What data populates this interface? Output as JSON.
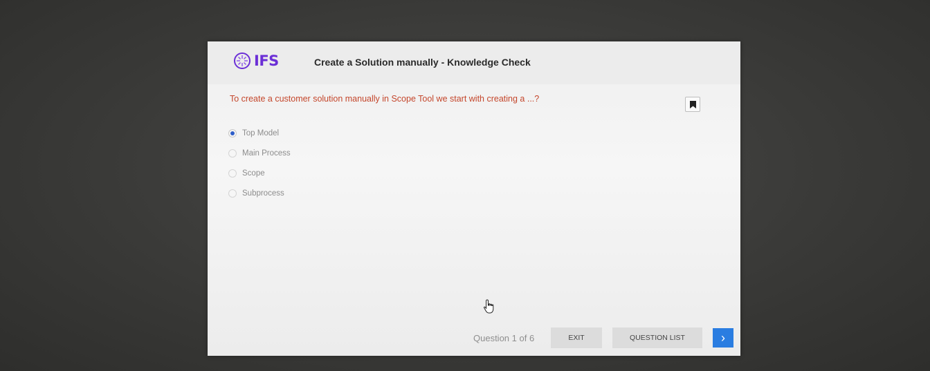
{
  "header": {
    "logo_text": "IFS",
    "course_title": "Create a Solution manually - Knowledge Check"
  },
  "question": {
    "text": "To create a customer solution manually in Scope Tool we start with creating a ...?",
    "options": [
      {
        "label": "Top Model",
        "selected": true
      },
      {
        "label": "Main Process",
        "selected": false
      },
      {
        "label": "Scope",
        "selected": false
      },
      {
        "label": "Subprocess",
        "selected": false
      }
    ]
  },
  "footer": {
    "counter": "Question 1 of 6",
    "exit_label": "EXIT",
    "question_list_label": "QUESTION LIST",
    "next_glyph": "›"
  },
  "colors": {
    "brand_purple": "#6b2fd6",
    "question_red": "#c4462b",
    "accent_blue": "#2a7de1"
  },
  "icons": [
    "ifs-logo-icon",
    "bookmark-icon",
    "chevron-right-icon",
    "hand-cursor-icon"
  ]
}
